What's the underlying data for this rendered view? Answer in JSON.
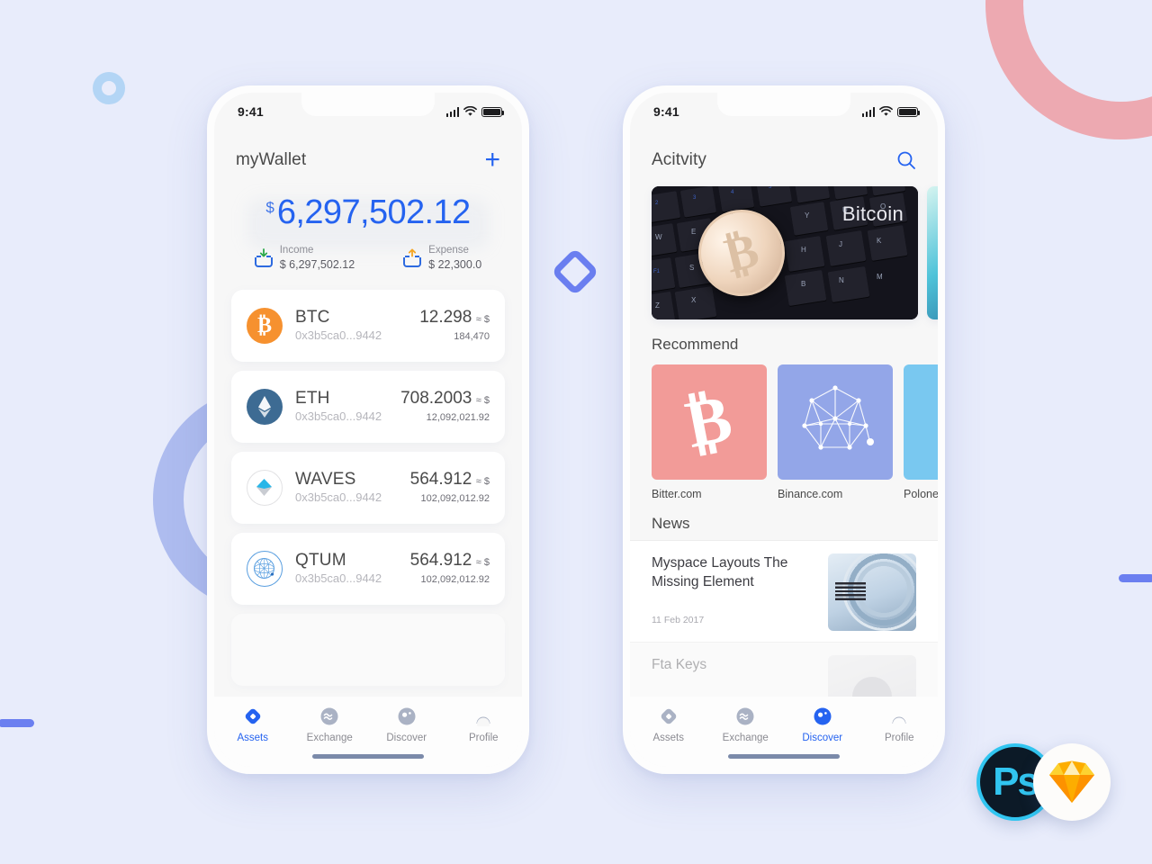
{
  "background": {
    "color": "#e8ecfb",
    "decor": [
      {
        "name": "pink-ring",
        "color": "#eda9b1"
      },
      {
        "name": "blue-ring-large",
        "color": "#aebcef"
      },
      {
        "name": "blue-ring-small",
        "color": "#b3d5f5"
      },
      {
        "name": "diamond-outline",
        "color": "#6b7ff0"
      },
      {
        "name": "bar-left",
        "color": "#6b7ff0"
      },
      {
        "name": "bar-right",
        "color": "#6b7ff0"
      }
    ]
  },
  "badges": {
    "photoshop": {
      "label": "Ps",
      "ring_color": "#31c5f0",
      "bg_color": "#0c1a27"
    },
    "sketch": {
      "label": "sketch-gem",
      "bg_color": "#ffffff",
      "gem_color": "#fdad00"
    }
  },
  "phone_assets": {
    "status": {
      "time": "9:41",
      "signal": "signal-icon",
      "wifi": "wifi-icon",
      "battery": "battery-icon"
    },
    "header": {
      "title": "myWallet",
      "add_label": "+"
    },
    "balance": {
      "currency": "$",
      "amount": "6,297,502.12",
      "color": "#2563f0"
    },
    "summary": [
      {
        "label": "Income",
        "value": "$ 6,297,502.12",
        "arrow": "down",
        "arrow_color": "#2aa84a"
      },
      {
        "label": "Expense",
        "value": "$ 22,300.0",
        "arrow": "up",
        "arrow_color": "#f5a623"
      }
    ],
    "assets": [
      {
        "symbol": "BTC",
        "address": "0x3b5ca0...9442",
        "amount": "12.298",
        "fiat": "≈ $ 184,470",
        "icon": "btc-icon",
        "icon_color": "#f6912f"
      },
      {
        "symbol": "ETH",
        "address": "0x3b5ca0...9442",
        "amount": "708.2003",
        "fiat": "≈ $ 12,092,021.92",
        "icon": "eth-icon",
        "icon_color": "#3d6b93"
      },
      {
        "symbol": "WAVES",
        "address": "0x3b5ca0...9442",
        "amount": "564.912",
        "fiat": "≈ $ 102,092,012.92",
        "icon": "waves-icon",
        "icon_color": "#29b6e8"
      },
      {
        "symbol": "QTUM",
        "address": "0x3b5ca0...9442",
        "amount": "564.912",
        "fiat": "≈ $ 102,092,012.92",
        "icon": "qtum-icon",
        "icon_color": "#5a9fe0"
      }
    ],
    "tabs": [
      {
        "label": "Assets",
        "icon": "diamond-icon",
        "active": true
      },
      {
        "label": "Exchange",
        "icon": "exchange-waves-icon",
        "active": false
      },
      {
        "label": "Discover",
        "icon": "compass-icon",
        "active": false
      },
      {
        "label": "Profile",
        "icon": "person-icon",
        "active": false
      }
    ]
  },
  "phone_discover": {
    "status": {
      "time": "9:41",
      "signal": "signal-icon",
      "wifi": "wifi-icon",
      "battery": "battery-icon"
    },
    "header": {
      "title": "Acitvity",
      "search": "search-icon"
    },
    "activity_cards": [
      {
        "caption": "Bitcoin",
        "image": "bitcoin-coin-on-keyboard"
      },
      {
        "caption": "",
        "image": "teal-abstract"
      }
    ],
    "recommend": {
      "section_title": "Recommend",
      "items": [
        {
          "name": "Bitter.com",
          "tile_color": "#f29b98",
          "icon": "bitcoin-symbol-icon"
        },
        {
          "name": "Binance.com",
          "tile_color": "#93a6e8",
          "icon": "network-polygon-icon"
        },
        {
          "name": "Polone",
          "tile_color": "#79c8f0",
          "icon": "generic-icon"
        }
      ]
    },
    "news": {
      "section_title": "News",
      "items": [
        {
          "title": "Myspace Layouts The Missing Element",
          "date": "11 Feb 2017",
          "thumb": "ibm-rings-thumb",
          "faded": false
        },
        {
          "title": "Fta Keys",
          "date": "",
          "thumb": "avatar-thumb",
          "faded": true
        }
      ]
    },
    "tabs": [
      {
        "label": "Assets",
        "icon": "diamond-icon",
        "active": false
      },
      {
        "label": "Exchange",
        "icon": "exchange-waves-icon",
        "active": false
      },
      {
        "label": "Discover",
        "icon": "compass-icon",
        "active": true
      },
      {
        "label": "Profile",
        "icon": "person-icon",
        "active": false
      }
    ]
  }
}
